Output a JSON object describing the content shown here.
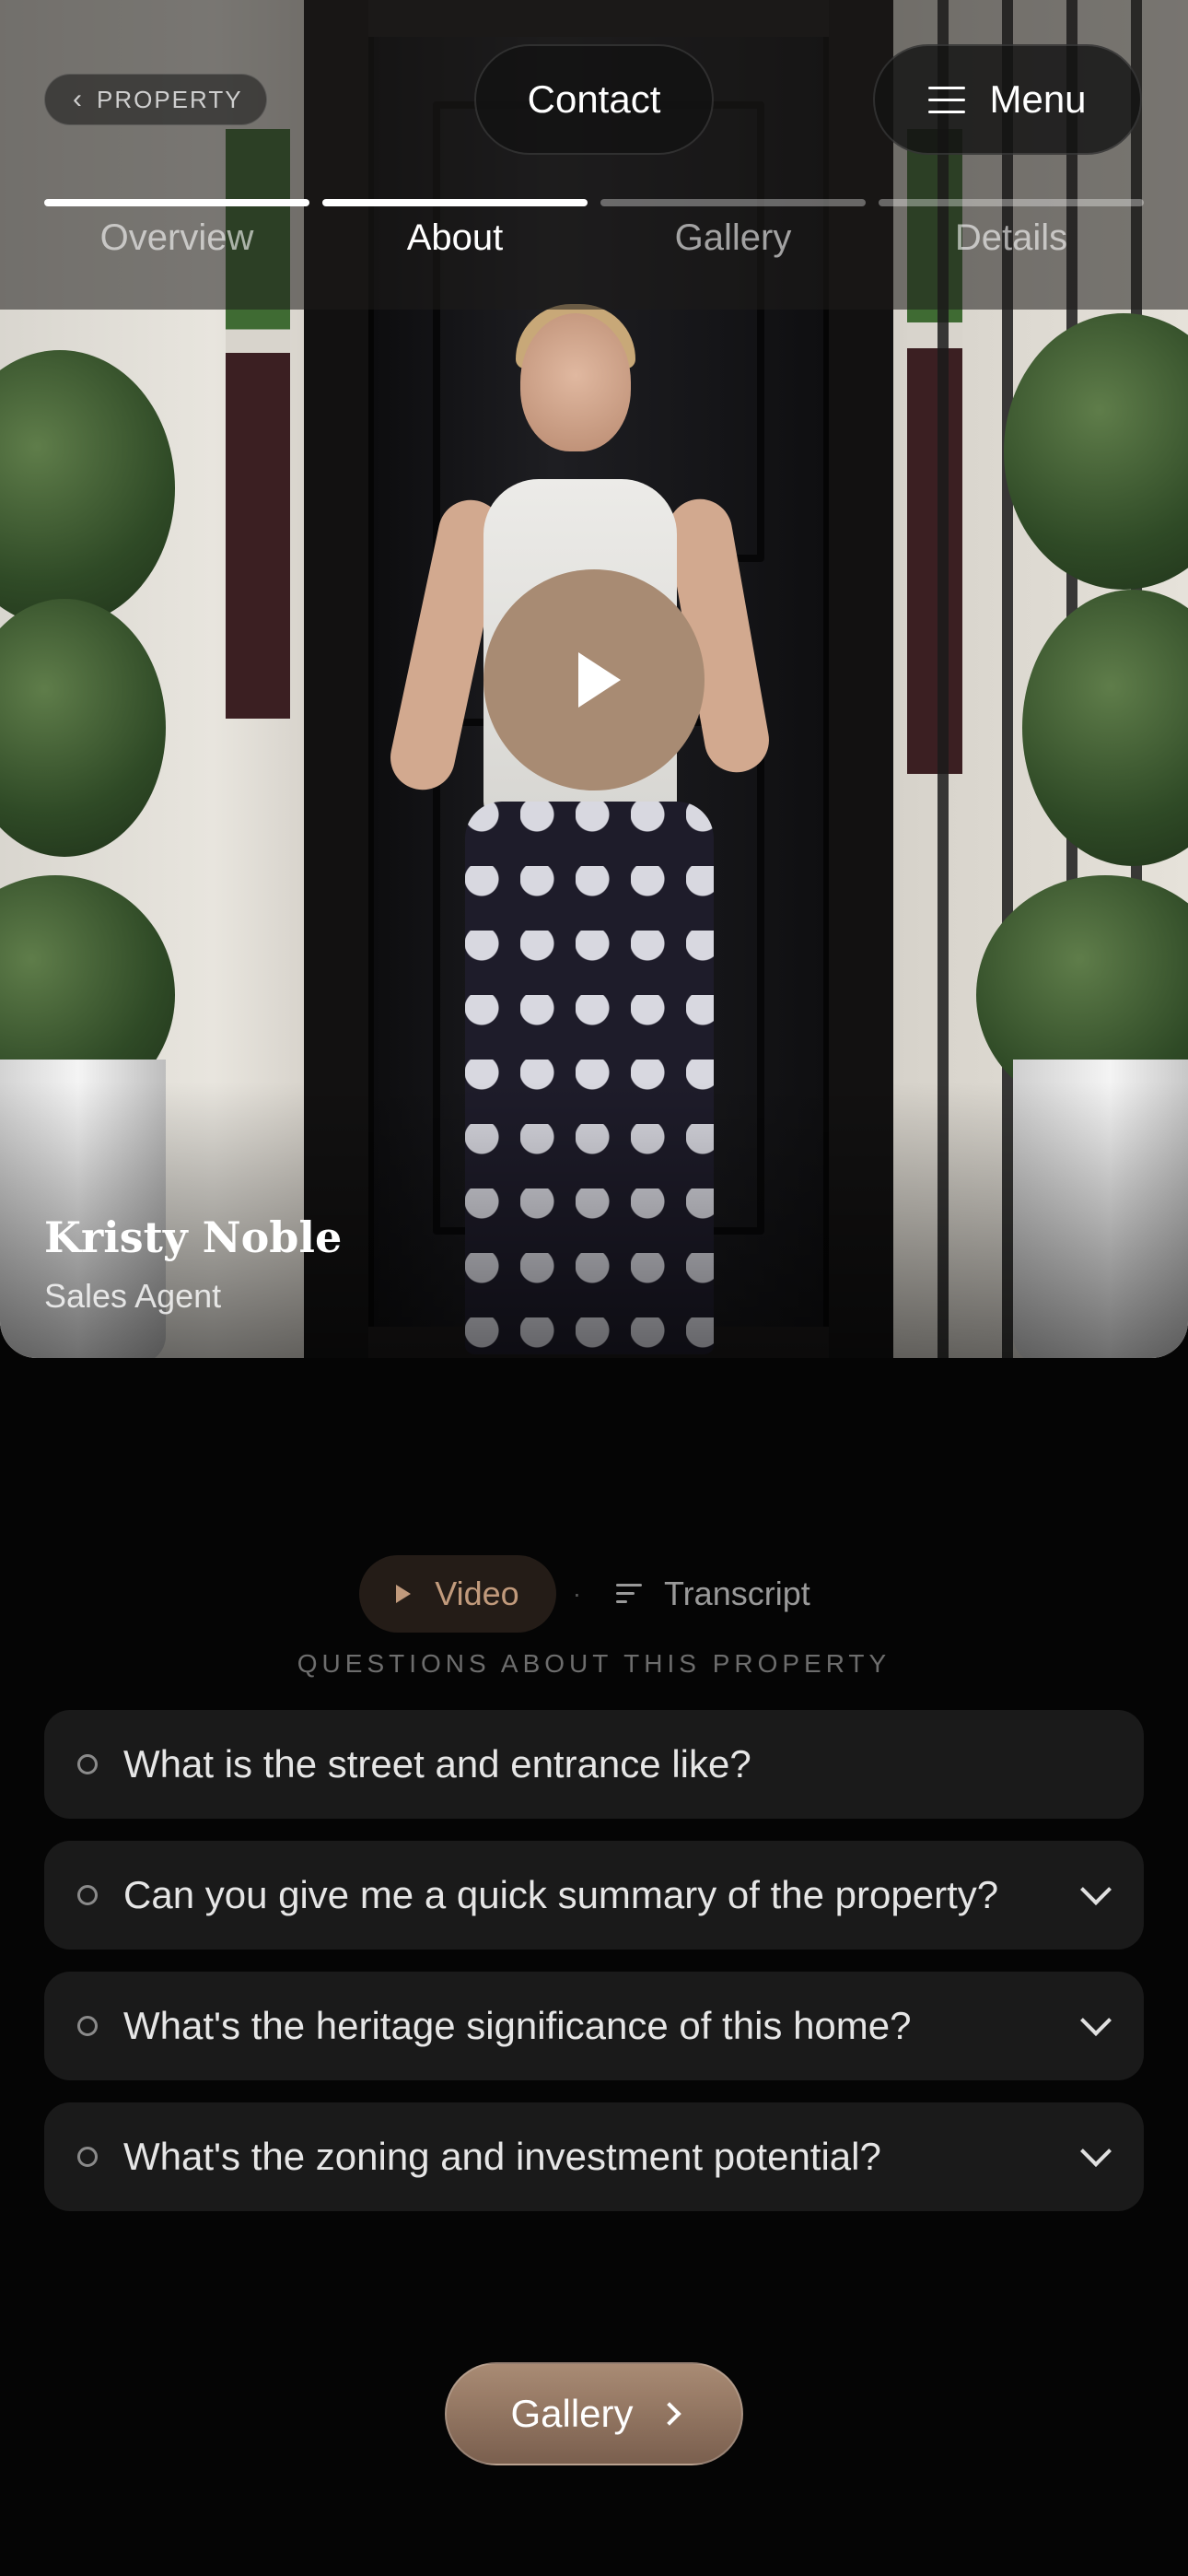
{
  "header": {
    "back_label": "PROPERTY",
    "contact_label": "Contact",
    "menu_label": "Menu"
  },
  "tabs": [
    {
      "label": "Overview",
      "progress": 1.0
    },
    {
      "label": "About",
      "progress": 1.0,
      "active": true
    },
    {
      "label": "Gallery",
      "progress": 0
    },
    {
      "label": "Details",
      "progress": 0
    }
  ],
  "video": {
    "play_icon": "play-icon",
    "agent_name": "Kristy Noble",
    "agent_role": "Sales Agent"
  },
  "mode": {
    "video_label": "Video",
    "separator": "·",
    "transcript_label": "Transcript"
  },
  "questions": {
    "heading": "QUESTIONS ABOUT THIS PROPERTY",
    "items": [
      {
        "text": "What is the street and entrance like?",
        "expandable": false
      },
      {
        "text": "Can you give me a quick summary of the property?",
        "expandable": true
      },
      {
        "text": "What's the heritage significance of this home?",
        "expandable": true
      },
      {
        "text": "What's the zoning and investment potential?",
        "expandable": true
      }
    ]
  },
  "footer": {
    "gallery_label": "Gallery"
  },
  "colors": {
    "accent": "#a88b73",
    "accent_text": "#c19a7c",
    "background": "#050505",
    "card": "#1a1a1a"
  }
}
